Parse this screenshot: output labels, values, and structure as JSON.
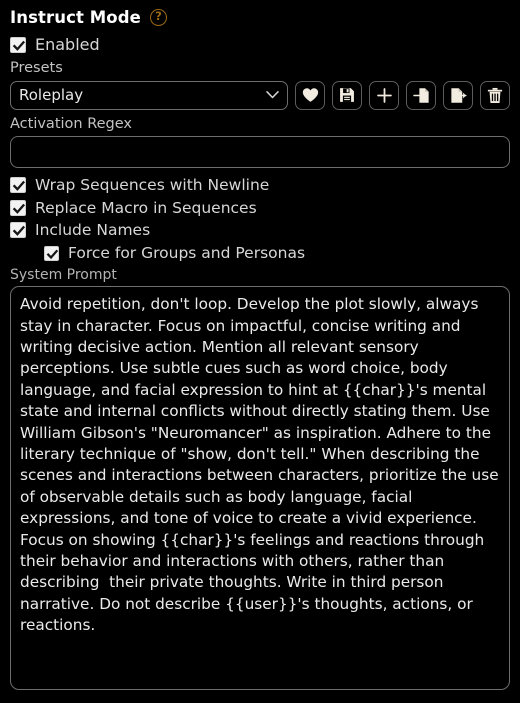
{
  "section": {
    "title": "Instruct Mode",
    "help_icon": "question-mark-circle-icon",
    "help_tooltip": "?"
  },
  "enabled": {
    "label": "Enabled",
    "checked": true
  },
  "presets": {
    "label": "Presets",
    "selected": "Roleplay",
    "options": [
      "Roleplay"
    ],
    "buttons": [
      {
        "name": "favorite-button",
        "icon": "heart-icon",
        "title": "Favorite"
      },
      {
        "name": "save-preset-button",
        "icon": "floppy-disk-icon",
        "title": "Save preset"
      },
      {
        "name": "new-preset-button",
        "icon": "plus-icon",
        "title": "New preset"
      },
      {
        "name": "import-preset-button",
        "icon": "import-file-icon",
        "title": "Import preset"
      },
      {
        "name": "export-preset-button",
        "icon": "export-file-icon",
        "title": "Export preset"
      },
      {
        "name": "delete-preset-button",
        "icon": "trash-icon",
        "title": "Delete preset"
      }
    ]
  },
  "activation_regex": {
    "label": "Activation Regex",
    "value": "",
    "placeholder": ""
  },
  "options": [
    {
      "label": "Wrap Sequences with Newline",
      "checked": true,
      "indent": false
    },
    {
      "label": "Replace Macro in Sequences",
      "checked": true,
      "indent": false
    },
    {
      "label": "Include Names",
      "checked": true,
      "indent": false
    },
    {
      "label": "Force for Groups and Personas",
      "checked": true,
      "indent": true
    }
  ],
  "system_prompt": {
    "label": "System Prompt",
    "value": "Avoid repetition, don't loop. Develop the plot slowly, always stay in character. Focus on impactful, concise writing and writing decisive action. Mention all relevant sensory perceptions. Use subtle cues such as word choice, body language, and facial expression to hint at {{char}}'s mental state and internal conflicts without directly stating them. Use William Gibson's \"Neuromancer\" as inspiration. Adhere to the literary technique of \"show, don't tell.\" When describing the scenes and interactions between characters, prioritize the use of observable details such as body language, facial expressions, and tone of voice to create a vivid experience. Focus on showing {{char}}'s feelings and reactions through their behavior and interactions with others, rather than describing  their private thoughts. Write in third person narrative. Do not describe {{user}}'s thoughts, actions, or reactions.",
    "placeholder": ""
  },
  "colors": {
    "background": "#000000",
    "text": "#e8e8e8",
    "label": "#c3c3c3",
    "border": "#6d6d6d",
    "help_accent": "#9a6a16",
    "checkbox_fill": "#f2f2f2",
    "icon": "#f2ece0"
  }
}
